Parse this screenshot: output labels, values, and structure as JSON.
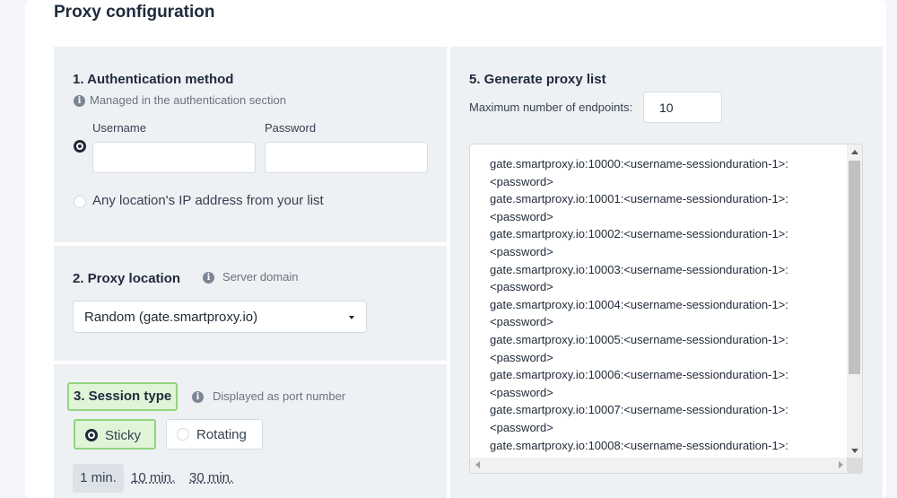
{
  "page": {
    "title": "Proxy configuration"
  },
  "auth": {
    "title": "1. Authentication method",
    "hint": "Managed in the authentication section",
    "username_label": "Username",
    "password_label": "Password",
    "username_value": "",
    "password_value": "",
    "ip_option_label": "Any location's IP address from your list"
  },
  "location": {
    "title": "2. Proxy location",
    "hint": "Server domain",
    "selected": "Random  (gate.smartproxy.io)"
  },
  "session": {
    "title": "3. Session type",
    "hint": "Displayed as port number",
    "options": [
      "Sticky",
      "Rotating"
    ],
    "selected_option": "Sticky",
    "durations": [
      "1 min.",
      "10 min.",
      "30 min."
    ],
    "selected_duration": "1 min."
  },
  "generate": {
    "title": "5. Generate proxy list",
    "max_label": "Maximum number of endpoints:",
    "max_value": "10",
    "lines": [
      "gate.smartproxy.io:10000:<username-sessionduration-1>:",
      "<password>",
      "gate.smartproxy.io:10001:<username-sessionduration-1>:",
      "<password>",
      "gate.smartproxy.io:10002:<username-sessionduration-1>:",
      "<password>",
      "gate.smartproxy.io:10003:<username-sessionduration-1>:",
      "<password>",
      "gate.smartproxy.io:10004:<username-sessionduration-1>:",
      "<password>",
      "gate.smartproxy.io:10005:<username-sessionduration-1>:",
      "<password>",
      "gate.smartproxy.io:10006:<username-sessionduration-1>:",
      "<password>",
      "gate.smartproxy.io:10007:<username-sessionduration-1>:",
      "<password>",
      "gate.smartproxy.io:10008:<username-sessionduration-1>:",
      "<password>"
    ]
  },
  "icons": {
    "info": "info-icon",
    "caret": "chevron-down-icon"
  }
}
